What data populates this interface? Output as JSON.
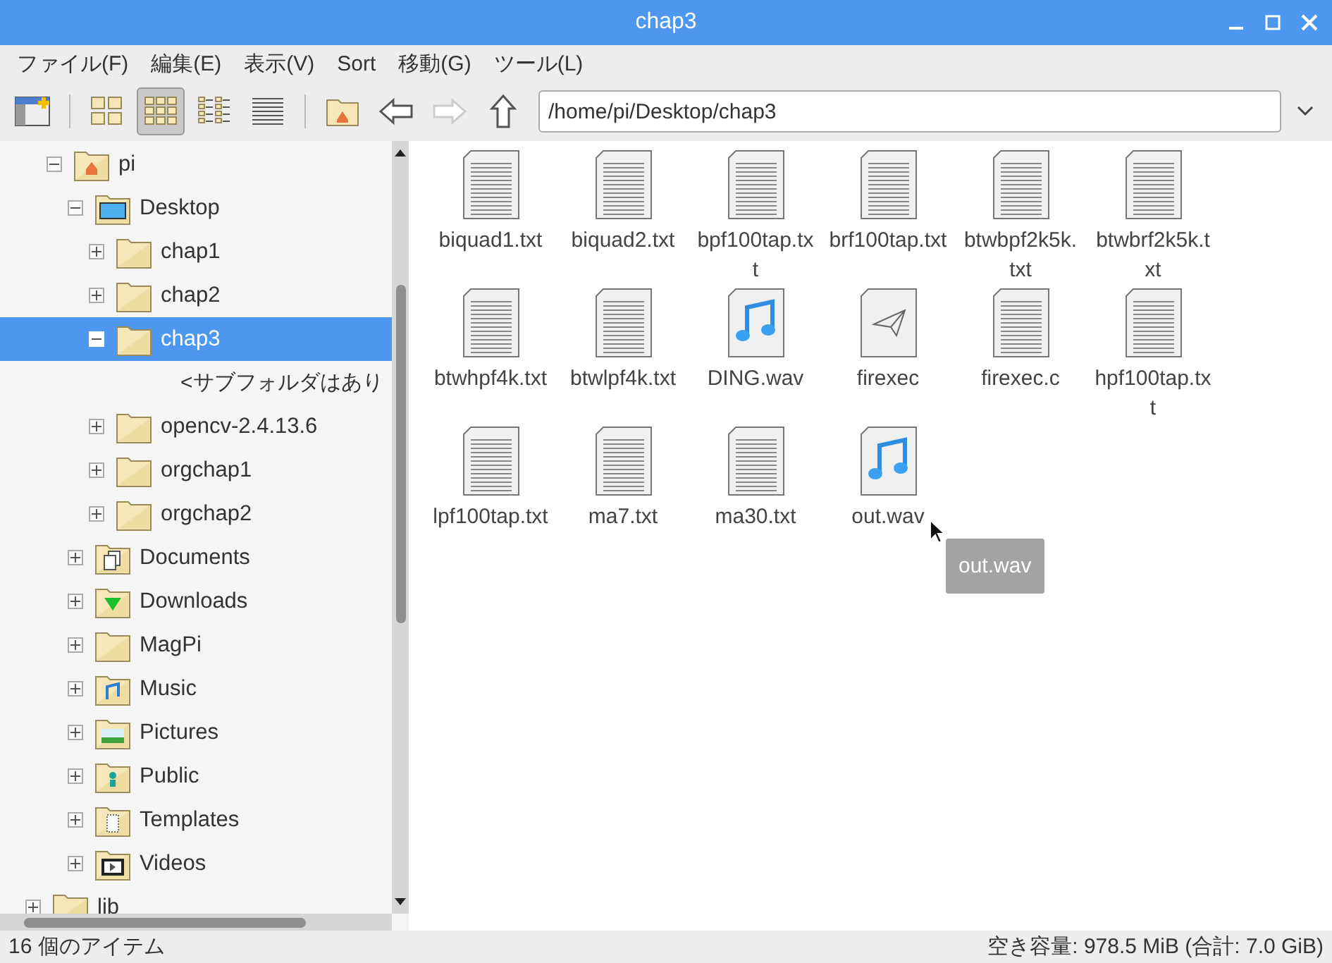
{
  "window": {
    "title": "chap3"
  },
  "menu": [
    "ファイル(F)",
    "編集(E)",
    "表示(V)",
    "Sort",
    "移動(G)",
    "ツール(L)"
  ],
  "toolbar": {
    "views": [
      {
        "kind": "icons",
        "selected": false
      },
      {
        "kind": "thumbs",
        "selected": true
      },
      {
        "kind": "compact",
        "selected": false
      },
      {
        "kind": "list",
        "selected": false
      }
    ],
    "forward_disabled": true,
    "path": "/home/pi/Desktop/chap3"
  },
  "tree": [
    {
      "kind": "offscreen",
      "children": [
        {
          "label": "pi",
          "kind": "home",
          "expanded": true,
          "selected": false,
          "children": [
            {
              "label": "Desktop",
              "kind": "desktop",
              "expanded": true,
              "selected": false,
              "children": [
                {
                  "label": "chap1",
                  "kind": "folder",
                  "expanded": false,
                  "selected": false
                },
                {
                  "label": "chap2",
                  "kind": "folder",
                  "expanded": false,
                  "selected": false
                },
                {
                  "label": "chap3",
                  "kind": "folder",
                  "expanded": true,
                  "selected": true,
                  "children": [
                    {
                      "kind": "note",
                      "label": "<サブフォルダはあり"
                    }
                  ]
                },
                {
                  "label": "opencv-2.4.13.6",
                  "kind": "folder",
                  "expanded": false,
                  "selected": false
                },
                {
                  "label": "orgchap1",
                  "kind": "folder",
                  "expanded": false,
                  "selected": false
                },
                {
                  "label": "orgchap2",
                  "kind": "folder",
                  "expanded": false,
                  "selected": false
                }
              ]
            },
            {
              "label": "Documents",
              "kind": "documents",
              "expanded": false,
              "selected": false
            },
            {
              "label": "Downloads",
              "kind": "downloads",
              "expanded": false,
              "selected": false
            },
            {
              "label": "MagPi",
              "kind": "folder",
              "expanded": false,
              "selected": false
            },
            {
              "label": "Music",
              "kind": "music",
              "expanded": false,
              "selected": false
            },
            {
              "label": "Pictures",
              "kind": "pictures",
              "expanded": false,
              "selected": false
            },
            {
              "label": "Public",
              "kind": "public",
              "expanded": false,
              "selected": false
            },
            {
              "label": "Templates",
              "kind": "templates",
              "expanded": false,
              "selected": false
            },
            {
              "label": "Videos",
              "kind": "videos",
              "expanded": false,
              "selected": false
            }
          ]
        }
      ]
    },
    {
      "label": "lib",
      "kind": "folder",
      "expanded": false,
      "selected": false
    }
  ],
  "files": [
    {
      "name": "biquad1.txt",
      "kind": "text"
    },
    {
      "name": "biquad2.txt",
      "kind": "text"
    },
    {
      "name": "bpf100tap.txt",
      "kind": "text"
    },
    {
      "name": "brf100tap.txt",
      "kind": "text"
    },
    {
      "name": "btwbpf2k5k.txt",
      "kind": "text"
    },
    {
      "name": "btwbrf2k5k.txt",
      "kind": "text"
    },
    {
      "name": "btwhpf4k.txt",
      "kind": "text"
    },
    {
      "name": "btwlpf4k.txt",
      "kind": "text"
    },
    {
      "name": "DING.wav",
      "kind": "audio"
    },
    {
      "name": "firexec",
      "kind": "exec"
    },
    {
      "name": "firexec.c",
      "kind": "text"
    },
    {
      "name": "hpf100tap.txt",
      "kind": "text"
    },
    {
      "name": "lpf100tap.txt",
      "kind": "text"
    },
    {
      "name": "ma7.txt",
      "kind": "text"
    },
    {
      "name": "ma30.txt",
      "kind": "text"
    },
    {
      "name": "out.wav",
      "kind": "audio"
    }
  ],
  "tooltip": "out.wav",
  "status_bar": {
    "count": "16 個のアイテム",
    "free_space": "空き容量: 978.5 MiB (合計: 7.0 GiB)"
  }
}
